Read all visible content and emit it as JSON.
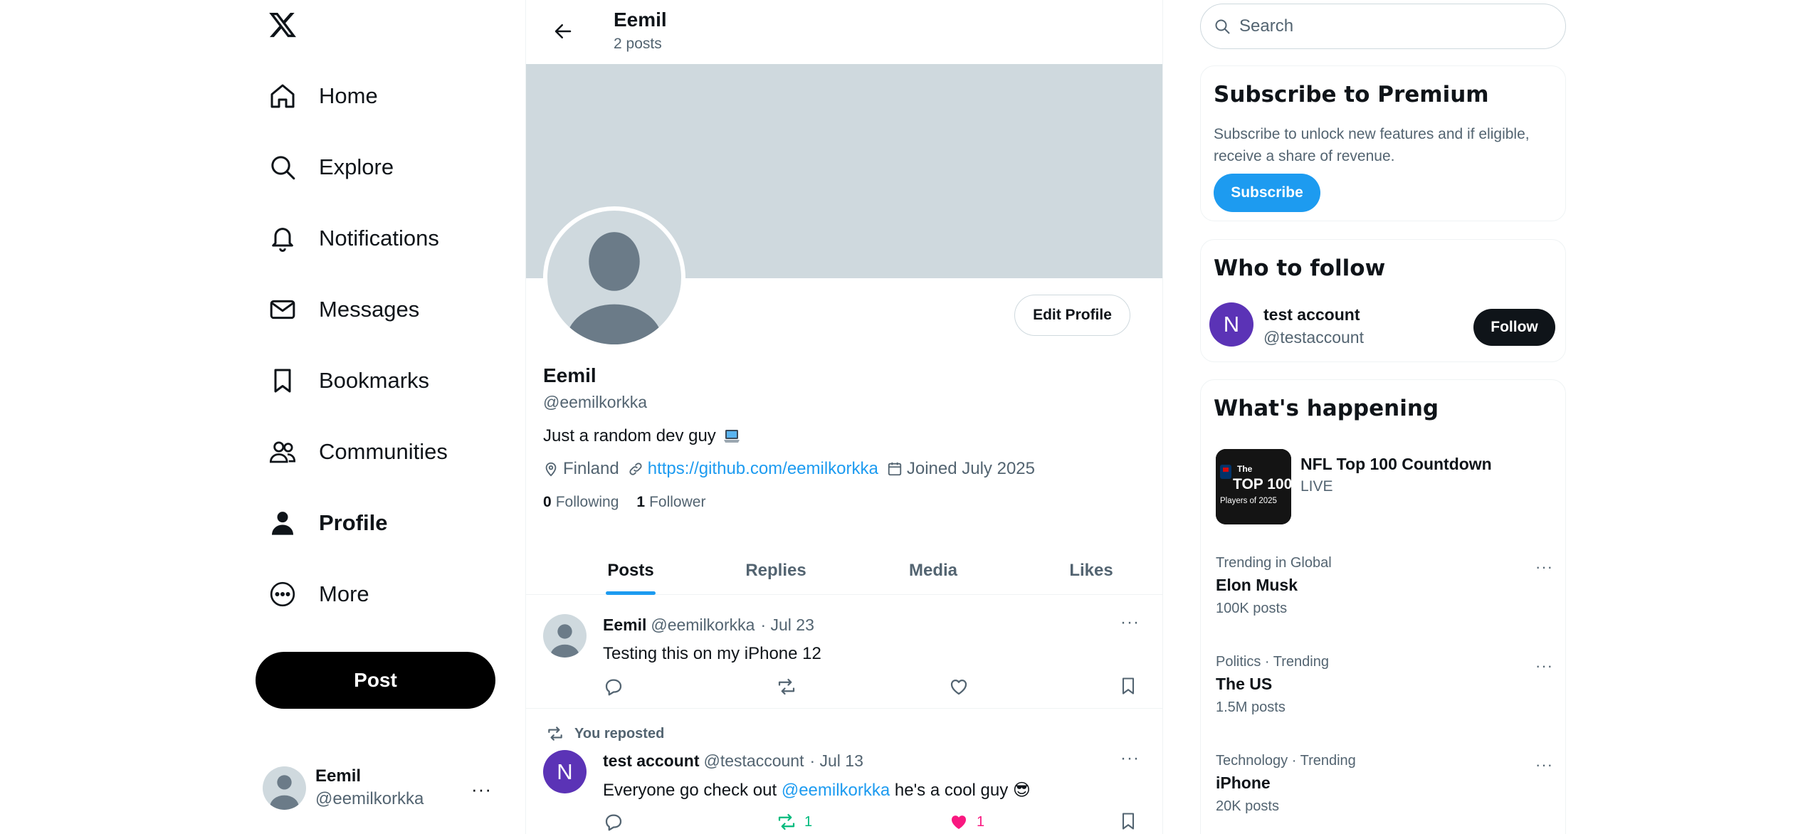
{
  "nav": {
    "items": [
      {
        "label": "Home",
        "icon": "home-icon"
      },
      {
        "label": "Explore",
        "icon": "search-icon"
      },
      {
        "label": "Notifications",
        "icon": "bell-icon"
      },
      {
        "label": "Messages",
        "icon": "mail-icon"
      },
      {
        "label": "Bookmarks",
        "icon": "bookmark-icon"
      },
      {
        "label": "Communities",
        "icon": "people-icon"
      },
      {
        "label": "Profile",
        "icon": "person-icon",
        "active": true
      },
      {
        "label": "More",
        "icon": "more-circle-icon"
      }
    ],
    "post_label": "Post",
    "account": {
      "name": "Eemil",
      "handle": "@eemilkorkka",
      "more": "···"
    }
  },
  "topbar": {
    "name": "Eemil",
    "post_count": "2 posts"
  },
  "profile": {
    "edit_label": "Edit Profile",
    "name": "Eemil",
    "handle": "@eemilkorkka",
    "bio": "Just a random dev guy",
    "location": "Finland",
    "website": "https://github.com/eemilkorkka",
    "joined": "Joined July 2025",
    "following_count": "0",
    "following_label": "Following",
    "followers_count": "1",
    "followers_label": "Follower"
  },
  "tabs": [
    "Posts",
    "Replies",
    "Media",
    "Likes"
  ],
  "posts": [
    {
      "author": "Eemil",
      "handle": "@eemilkorkka",
      "date": "· Jul 23",
      "text": "Testing this on my iPhone 12"
    },
    {
      "reposted_label": "You reposted",
      "avatar_letter": "N",
      "author": "test account",
      "handle": "@testaccount",
      "date": "· Jul 13",
      "text_before": "Everyone go check out ",
      "mention": "@eemilkorkka",
      "text_after": " he's a cool guy 😎",
      "retweets": "1",
      "likes": "1"
    }
  ],
  "search": {
    "placeholder": "Search"
  },
  "premium": {
    "title": "Subscribe to Premium",
    "text": "Subscribe to unlock new features and if eligible, receive a share of revenue.",
    "button": "Subscribe"
  },
  "who_to_follow": {
    "title": "Who to follow",
    "avatar_letter": "N",
    "name": "test account",
    "handle": "@testaccount",
    "button": "Follow"
  },
  "happening": {
    "title": "What's happening",
    "featured": {
      "title": "NFL Top 100 Countdown",
      "status": "LIVE",
      "img_line1": "The",
      "img_line2": "TOP 100",
      "img_line3": "Players of 2025"
    },
    "trends": [
      {
        "context": "Trending in Global",
        "topic": "Elon Musk",
        "count": "100K posts"
      },
      {
        "context": "Politics · Trending",
        "topic": "The US",
        "count": "1.5M posts"
      },
      {
        "context": "Technology · Trending",
        "topic": "iPhone",
        "count": "20K posts"
      }
    ]
  },
  "colors": {
    "accent": "#1d9bf0",
    "text": "#0f1419",
    "muted": "#536471",
    "banner": "#cfd9de",
    "like": "#f91880",
    "repost": "#00ba7c",
    "avatar_purple": "#5b33b6"
  }
}
